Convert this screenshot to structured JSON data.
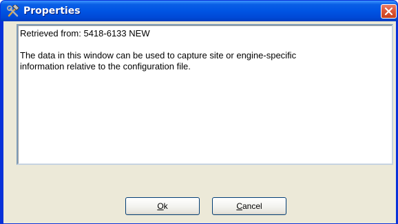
{
  "window": {
    "title": "Properties",
    "icon": "tools-icon",
    "close_icon": "close-icon"
  },
  "content": {
    "line1": "Retrieved from: 5418-6133 NEW",
    "line2": "The data in this window can be used to capture site or engine-specific",
    "line3": "information relative to the configuration file."
  },
  "buttons": {
    "ok_mnemonic": "O",
    "ok_rest": "k",
    "cancel_mnemonic": "C",
    "cancel_rest": "ancel"
  },
  "colors": {
    "titlebar": "#0054e3",
    "close_button": "#e05a3a",
    "dialog_background": "#ece9d8",
    "text_area_border": "#7f9db9"
  }
}
